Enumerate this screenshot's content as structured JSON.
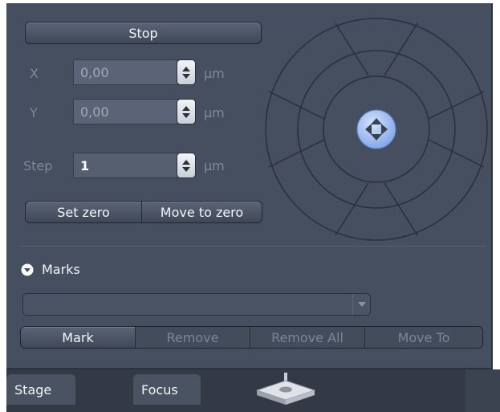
{
  "stop_button": {
    "label": "Stop"
  },
  "position": {
    "x": {
      "label": "X",
      "value": "0,00",
      "unit": "µm"
    },
    "y": {
      "label": "Y",
      "value": "0,00",
      "unit": "µm"
    }
  },
  "step": {
    "label": "Step",
    "value": "1",
    "unit": "µm"
  },
  "zero_buttons": {
    "set_zero": "Set zero",
    "move_to_zero": "Move to zero"
  },
  "marks": {
    "header": "Marks",
    "dropdown_value": "",
    "buttons": {
      "mark": "Mark",
      "remove": "Remove",
      "remove_all": "Remove All",
      "move_to": "Move To"
    }
  },
  "tabs": {
    "stage": "Stage",
    "focus": "Focus"
  },
  "icons": {
    "joystick": "four-direction-arrow-icon",
    "marks_toggle": "chevron-down-circle-icon",
    "spin": "up-down-arrows-icon",
    "dropdown": "caret-down-icon",
    "stage": "microscope-stage-icon"
  },
  "colors": {
    "panel": "#454f60",
    "tabbar": "#333a46",
    "joystick": "#8fb2ec"
  }
}
